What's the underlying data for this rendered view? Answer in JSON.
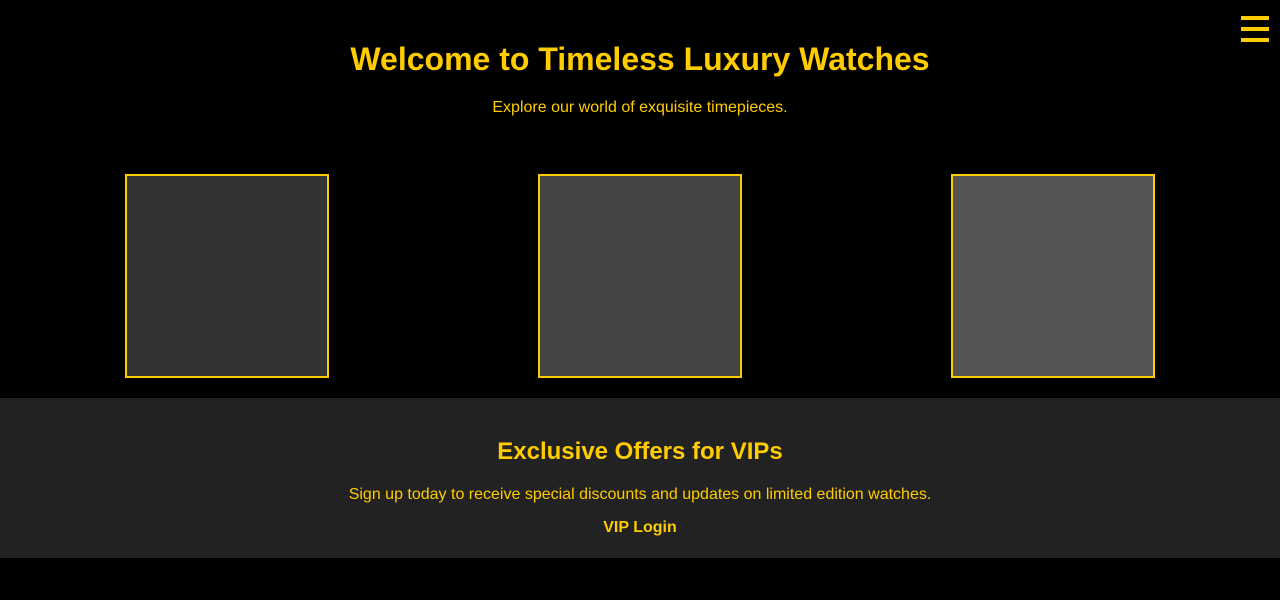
{
  "header": {
    "menu_icon": "hamburger-menu-icon",
    "accent_color": "#ffcc00"
  },
  "hero": {
    "title": "Welcome to Timeless Luxury Watches",
    "subtitle": "Explore our world of exquisite timepieces."
  },
  "gallery": {
    "items": [
      {
        "color": "#333333"
      },
      {
        "color": "#444444"
      },
      {
        "color": "#555555"
      }
    ]
  },
  "offers": {
    "title": "Exclusive Offers for VIPs",
    "text": "Sign up today to receive special discounts and updates on limited edition watches.",
    "vip_login_label": "VIP Login"
  },
  "colors": {
    "background": "#000000",
    "accent": "#ffcc00",
    "offers_background": "#222222"
  }
}
